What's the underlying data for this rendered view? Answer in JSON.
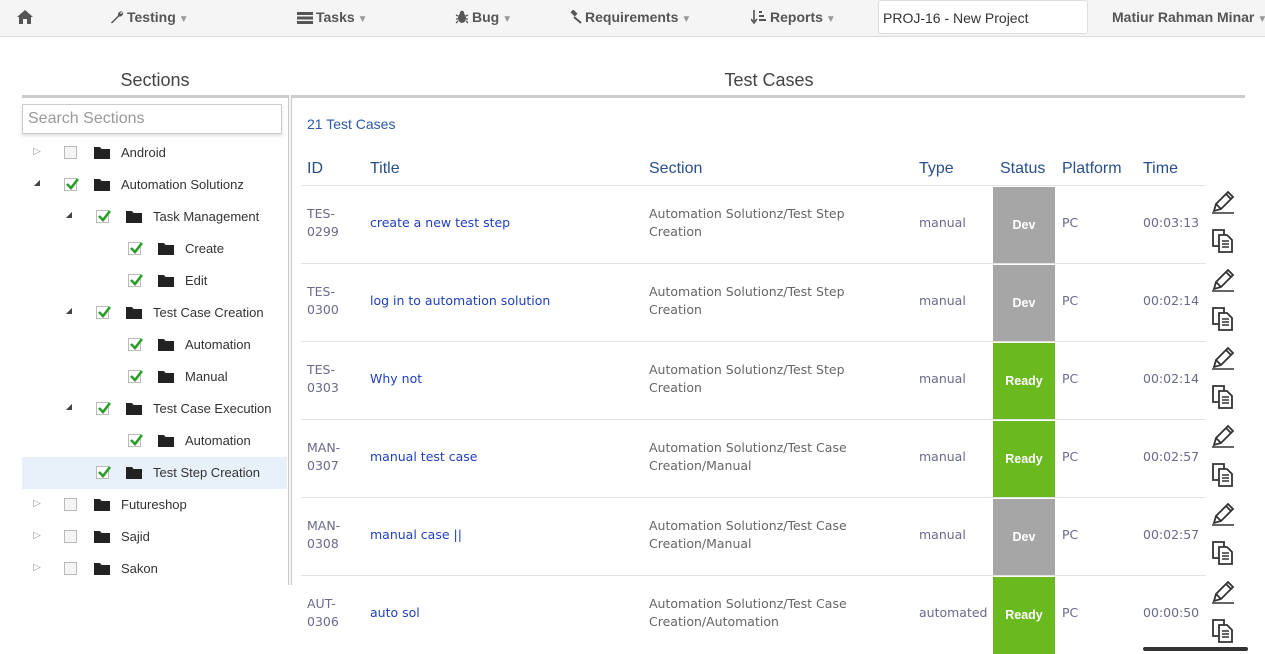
{
  "nav": {
    "home_icon": "home-icon",
    "testing": "Testing",
    "tasks": "Tasks",
    "bug": "Bug",
    "requirements": "Requirements",
    "reports": "Reports",
    "project": "PROJ-16 - New Project",
    "user": "Matiur Rahman Minar"
  },
  "sections": {
    "title": "Sections",
    "search_placeholder": "Search Sections",
    "items": [
      {
        "label": "Android",
        "checked": false,
        "expanded": false
      },
      {
        "label": "Automation Solutionz",
        "checked": true,
        "expanded": true
      },
      {
        "label": "Task Management",
        "checked": true,
        "expanded": true
      },
      {
        "label": "Create",
        "checked": true
      },
      {
        "label": "Edit",
        "checked": true
      },
      {
        "label": "Test Case Creation",
        "checked": true,
        "expanded": true
      },
      {
        "label": "Automation",
        "checked": true
      },
      {
        "label": "Manual",
        "checked": true
      },
      {
        "label": "Test Case Execution",
        "checked": true,
        "expanded": true
      },
      {
        "label": "Automation",
        "checked": true
      },
      {
        "label": "Test Step Creation",
        "checked": true,
        "selected": true
      },
      {
        "label": "Futureshop",
        "checked": false,
        "expanded": false
      },
      {
        "label": "Sajid",
        "checked": false,
        "expanded": false
      },
      {
        "label": "Sakon",
        "checked": false,
        "expanded": false
      }
    ]
  },
  "cases": {
    "title": "Test Cases",
    "count_label": "21 Test Cases",
    "columns": [
      "ID",
      "Title",
      "Section",
      "Type",
      "Status",
      "Platform",
      "Time"
    ],
    "rows": [
      {
        "id1": "TES-",
        "id2": "0299",
        "title": "create a new test step",
        "sec1": "Automation Solutionz/Test Step",
        "sec2": "Creation",
        "type": "manual",
        "status": "Dev",
        "platform": "PC",
        "time": "00:03:13"
      },
      {
        "id1": "TES-",
        "id2": "0300",
        "title": "log in to automation solution",
        "sec1": "Automation Solutionz/Test Step",
        "sec2": "Creation",
        "type": "manual",
        "status": "Dev",
        "platform": "PC",
        "time": "00:02:14"
      },
      {
        "id1": "TES-",
        "id2": "0303",
        "title": "Why not",
        "sec1": "Automation Solutionz/Test Step",
        "sec2": "Creation",
        "type": "manual",
        "status": "Ready",
        "platform": "PC",
        "time": "00:02:14"
      },
      {
        "id1": "MAN-",
        "id2": "0307",
        "title": "manual test case",
        "sec1": "Automation Solutionz/Test Case",
        "sec2": "Creation/Manual",
        "type": "manual",
        "status": "Ready",
        "platform": "PC",
        "time": "00:02:57"
      },
      {
        "id1": "MAN-",
        "id2": "0308",
        "title": "manual case ||",
        "sec1": "Automation Solutionz/Test Case",
        "sec2": "Creation/Manual",
        "type": "manual",
        "status": "Dev",
        "platform": "PC",
        "time": "00:02:57"
      },
      {
        "id1": "AUT-",
        "id2": "0306",
        "title": "auto sol",
        "sec1": "Automation Solutionz/Test Case",
        "sec2": "Creation/Automation",
        "type": "automated",
        "status": "Ready",
        "platform": "PC",
        "time": "00:00:50"
      }
    ],
    "status_colors": {
      "Dev": "#a6a6a6",
      "Ready": "#6ab91e"
    }
  }
}
